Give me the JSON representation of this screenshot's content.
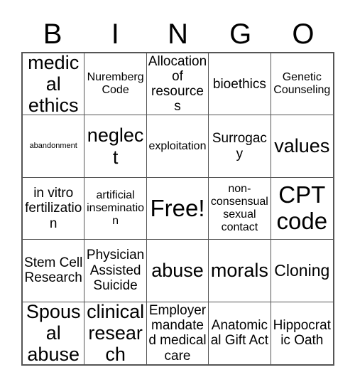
{
  "card": {
    "title_letters": [
      "B",
      "I",
      "N",
      "G",
      "O"
    ],
    "free_space_label": "Free!",
    "colors": {
      "background": "#ffffff",
      "text": "#000000",
      "grid_line": "#555555"
    },
    "rows": [
      [
        {
          "text": "medical ethics",
          "size": "fs-xl"
        },
        {
          "text": "Nuremberg Code",
          "size": "fs-s"
        },
        {
          "text": "Allocation of resources",
          "size": "fs-m"
        },
        {
          "text": "bioethics",
          "size": "fs-m"
        },
        {
          "text": "Genetic Counseling",
          "size": "fs-s"
        }
      ],
      [
        {
          "text": "abandonment",
          "size": "fs-xxs"
        },
        {
          "text": "neglect",
          "size": "fs-xl"
        },
        {
          "text": "exploitation",
          "size": "fs-s"
        },
        {
          "text": "Surrogacy",
          "size": "fs-m"
        },
        {
          "text": "values",
          "size": "fs-xl"
        }
      ],
      [
        {
          "text": "in vitro fertilization",
          "size": "fs-m"
        },
        {
          "text": "artificial insemination",
          "size": "fs-s"
        },
        {
          "text": "Free!",
          "size": "fs-xxl"
        },
        {
          "text": "non-consensual sexual contact",
          "size": "fs-s"
        },
        {
          "text": "CPT code",
          "size": "fs-xxl"
        }
      ],
      [
        {
          "text": "Stem Cell Research",
          "size": "fs-m"
        },
        {
          "text": "Physician Assisted Suicide",
          "size": "fs-m"
        },
        {
          "text": "abuse",
          "size": "fs-xl"
        },
        {
          "text": "morals",
          "size": "fs-xl"
        },
        {
          "text": "Cloning",
          "size": "fs-l"
        }
      ],
      [
        {
          "text": "Spousal abuse",
          "size": "fs-xl"
        },
        {
          "text": "clinical research",
          "size": "fs-xl"
        },
        {
          "text": "Employer mandated medical care",
          "size": "fs-m"
        },
        {
          "text": "Anatomical Gift Act",
          "size": "fs-m"
        },
        {
          "text": "Hippocratic Oath",
          "size": "fs-m"
        }
      ]
    ]
  }
}
